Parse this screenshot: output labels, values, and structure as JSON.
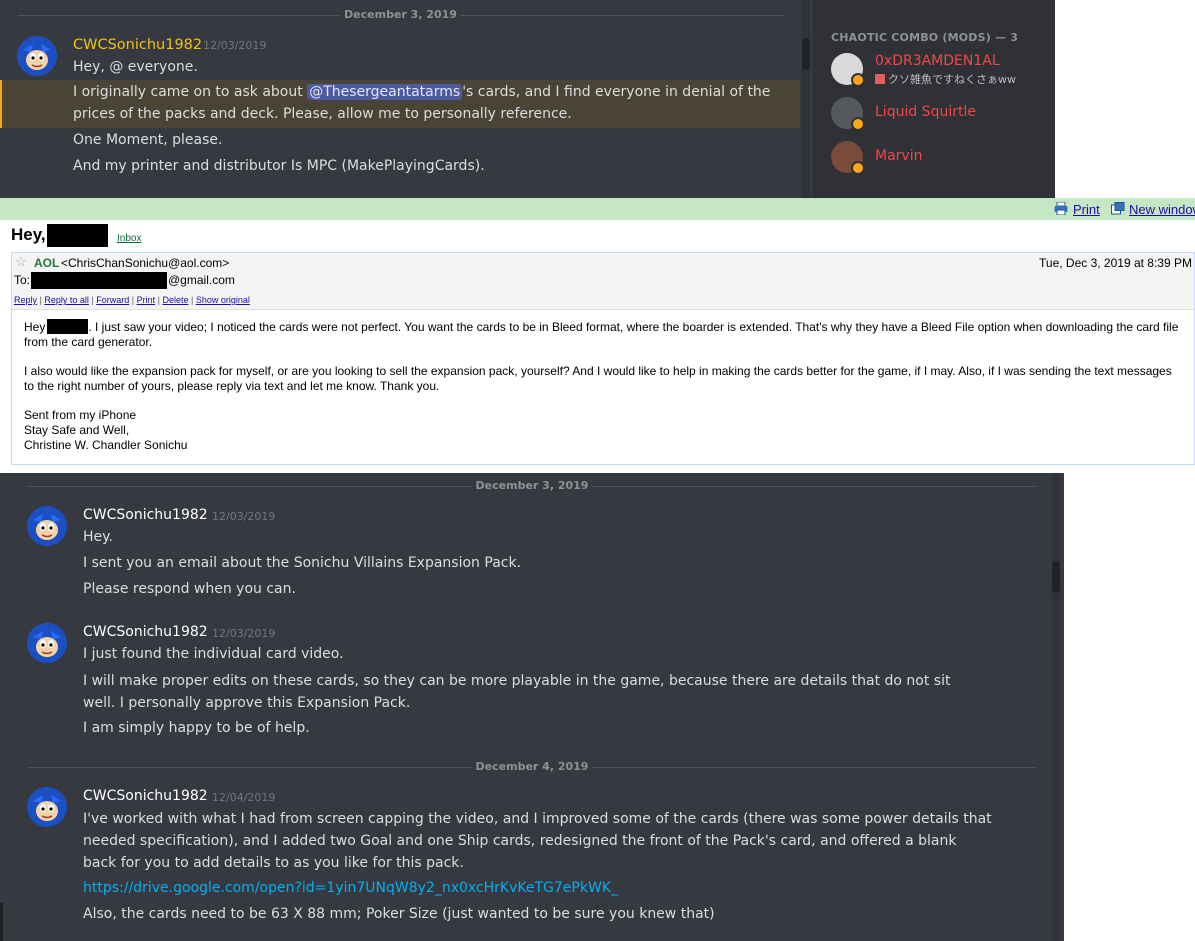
{
  "discord_top": {
    "date_divider": "December 3, 2019",
    "message": {
      "author": "CWCSonichu1982",
      "timestamp": "12/03/2019",
      "line1": "Hey, @ everyone.",
      "line2_prefix": "I originally came on to ask about ",
      "line2_mention": "@Thesergeantatarms",
      "line2_suffix": "'s cards, and I find everyone in denial of the",
      "line3": "prices of the packs and deck.  Please, allow me to personally reference.",
      "line4": "One Moment, please.",
      "line5": "And my printer and distributor Is MPC (MakePlayingCards)."
    },
    "members": {
      "section_title": "CHAOTIC COMBO (MODS) — 3",
      "items": [
        {
          "name": "0xDR3AMDEN1AL",
          "status": "クソ雑魚ですねくさぁww"
        },
        {
          "name": "Liquid Squirtle"
        },
        {
          "name": "Marvin"
        }
      ]
    }
  },
  "email": {
    "toolbar": {
      "print_label": "Print",
      "new_window_label": "New window"
    },
    "subject": "Hey,",
    "inbox_label": "Inbox",
    "from_name": "AOL",
    "from_addr": "<ChrisChanSonichu@aol.com>",
    "date": "Tue, Dec 3, 2019 at 8:39 PM",
    "to_label": "To:",
    "to_addr": "@gmail.com",
    "actions": [
      "Reply",
      "Reply to all",
      "Forward",
      "Print",
      "Delete",
      "Show original"
    ],
    "body": {
      "greeting": "Hey",
      "p1": ".  I just saw your video; I noticed the cards were not perfect.  You want the cards to be in Bleed format, where the boarder is extended.  That's why they have a Bleed File option when downloading the card file from the card generator.",
      "p2": "I also would like the expansion pack for myself, or are you looking to sell the expansion pack, yourself?  And I would like to help in making the cards better for the game, if I may.  Also, if I was sending the text messages to the right number of yours, please reply via text and let me know.  Thank you.",
      "sig1": "Sent from my iPhone",
      "sig2": "Stay Safe and Well,",
      "sig3": "Christine W. Chandler Sonichu"
    }
  },
  "discord_bottom": {
    "divider1": "December 3, 2019",
    "divider2": "December 4, 2019",
    "messages": [
      {
        "author": "CWCSonichu1982",
        "timestamp": "12/03/2019",
        "lines": [
          "Hey.",
          "I sent you an email about the Sonichu Villains Expansion Pack.",
          "Please respond when you can."
        ]
      },
      {
        "author": "CWCSonichu1982",
        "timestamp": "12/03/2019",
        "lines": [
          "I just found the individual card video.",
          "I will make proper edits on these cards, so they can be more playable in the game, because there are details that do not sit well.  I personally approve this Expansion Pack.",
          "I am simply happy to be of help."
        ]
      },
      {
        "author": "CWCSonichu1982",
        "timestamp": "12/04/2019",
        "lines": [
          "I've worked with what I had from screen capping the video, and I improved some of the cards (there was some power details that needed specification), and I added two Goal and one Ship cards, redesigned the front of the Pack's card, and offered a blank back for you to add details to as you like for this pack.",
          "https://drive.google.com/open?id=1yin7UNqW8y2_nx0xcHrKvKeTG7ePkWK_",
          "Also, the cards need to be 63 X 88 mm; Poker Size (just wanted to be sure you knew that)"
        ]
      }
    ]
  },
  "colors": {
    "discord_bg": "#36393f",
    "member_list_bg": "#2f3136",
    "highlight_bg": "#494436",
    "highlight_border": "#faa61a",
    "mod_name": "#f04747",
    "author_gold": "#f1c40f",
    "link": "#00b0f4",
    "email_toolbar_bg": "#c5e7c3"
  }
}
